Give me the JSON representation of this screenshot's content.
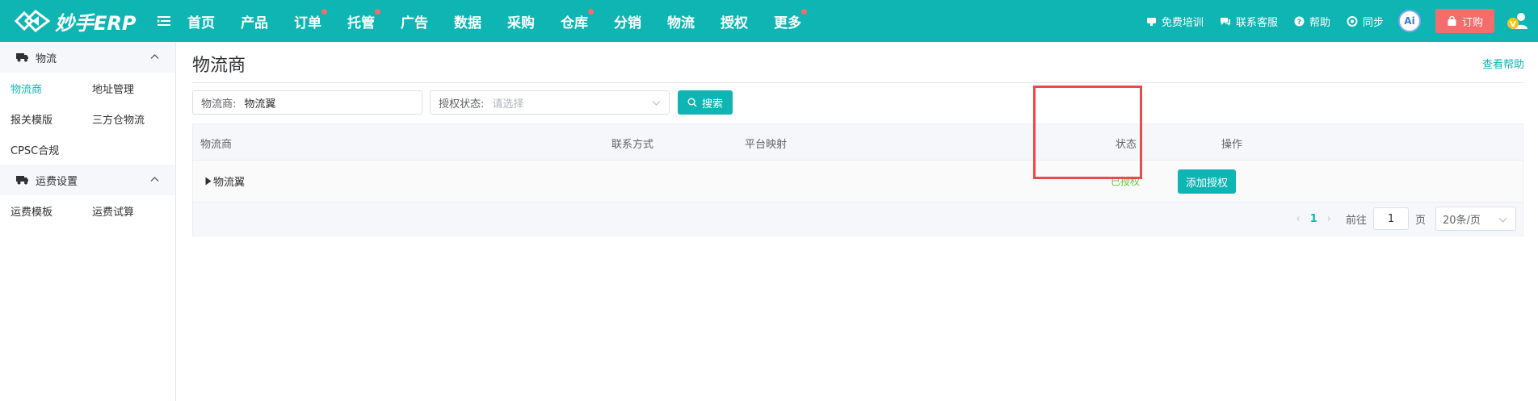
{
  "app": {
    "logo_text": "妙手ERP"
  },
  "nav": [
    {
      "label": "首页",
      "dot": false
    },
    {
      "label": "产品",
      "dot": false
    },
    {
      "label": "订单",
      "dot": true
    },
    {
      "label": "托管",
      "dot": true
    },
    {
      "label": "广告",
      "dot": false
    },
    {
      "label": "数据",
      "dot": false
    },
    {
      "label": "采购",
      "dot": false
    },
    {
      "label": "仓库",
      "dot": true
    },
    {
      "label": "分销",
      "dot": false
    },
    {
      "label": "物流",
      "dot": false
    },
    {
      "label": "授权",
      "dot": false
    },
    {
      "label": "更多",
      "dot": true
    }
  ],
  "tools": {
    "training": "免费培训",
    "support": "联系客服",
    "help": "帮助",
    "sync": "同步",
    "ai": "Ai",
    "order": "订购"
  },
  "sidebar": {
    "group1": {
      "title": "物流"
    },
    "group1_links": [
      [
        "物流商",
        "地址管理"
      ],
      [
        "报关模版",
        "三方仓物流"
      ],
      [
        "CPSC合规"
      ]
    ],
    "group2": {
      "title": "运费设置"
    },
    "group2_links": [
      [
        "运费模板",
        "运费试算"
      ]
    ]
  },
  "main": {
    "title": "物流商",
    "help": "查看帮助",
    "filters": {
      "carrier_label": "物流商:",
      "carrier_value": "物流翼",
      "status_label": "授权状态:",
      "status_placeholder": "请选择",
      "search": "搜索"
    },
    "table": {
      "headers": {
        "carrier": "物流商",
        "contact": "联系方式",
        "mapping": "平台映射",
        "status": "状态",
        "action": "操作"
      },
      "rows": [
        {
          "carrier": "物流翼",
          "status": "已授权",
          "action": "添加授权"
        }
      ]
    },
    "pager": {
      "page": "1",
      "goto_label": "前往",
      "goto_value": "1",
      "page_unit": "页",
      "page_size": "20条/页"
    }
  },
  "colors": {
    "brand": "#0fb5b3",
    "danger": "#f56c6c",
    "success": "#67c23a",
    "highlight": "#ea4a4a"
  }
}
